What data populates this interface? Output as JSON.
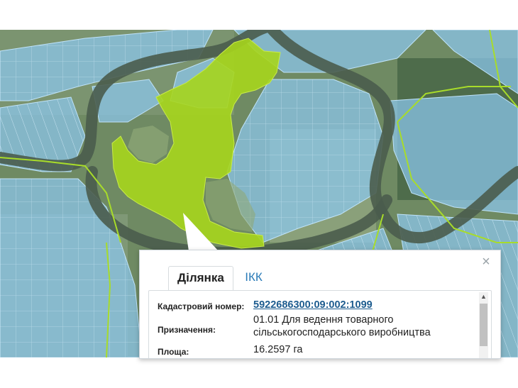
{
  "map": {
    "colors": {
      "imagery_green": "#6f8a63",
      "river": "#4a5c4c",
      "parcel_blue": "#8cc8ee",
      "selected_parcel": "#a6d51c",
      "boundary_line": "#a8dc2a"
    }
  },
  "popup": {
    "close_icon": "×",
    "tabs": [
      {
        "label": "Ділянка",
        "active": true
      },
      {
        "label": "ІКК",
        "active": false
      }
    ],
    "fields": {
      "cadastral_label": "Кадастровий номер:",
      "cadastral_value": "5922686300:09:002:1099",
      "purpose_label": "Призначення:",
      "purpose_value_line1": "01.01 Для ведення товарного",
      "purpose_value_line2": "сільськогосподарського виробництва",
      "area_label": "Площа:",
      "area_value": "16.2597 га"
    },
    "scroll_up_icon": "▲"
  }
}
